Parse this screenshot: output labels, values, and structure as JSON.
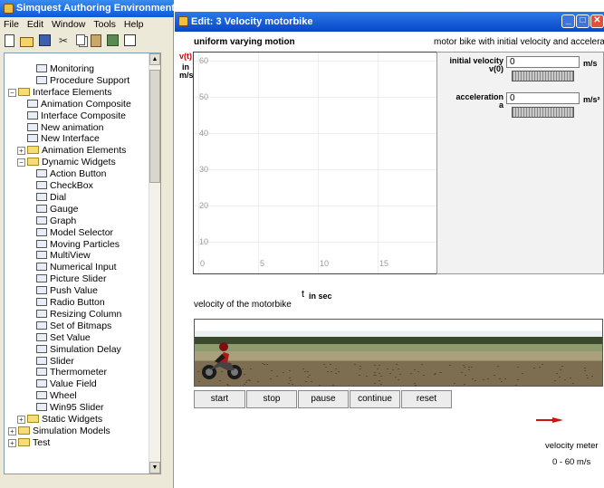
{
  "left_window": {
    "title": "Simquest Authoring Environment",
    "menu": [
      "File",
      "Edit",
      "Window",
      "Tools",
      "Help"
    ],
    "tree": [
      {
        "label": "Monitoring",
        "indent": 3,
        "type": "leaf"
      },
      {
        "label": "Procedure Support",
        "indent": 3,
        "type": "leaf"
      },
      {
        "label": "Interface Elements",
        "indent": 1,
        "type": "folder",
        "expander": "−"
      },
      {
        "label": "Animation Composite",
        "indent": 2,
        "type": "leaf"
      },
      {
        "label": "Interface Composite",
        "indent": 2,
        "type": "leaf"
      },
      {
        "label": "New animation",
        "indent": 2,
        "type": "leaf"
      },
      {
        "label": "New Interface",
        "indent": 2,
        "type": "leaf"
      },
      {
        "label": "Animation Elements",
        "indent": 2,
        "type": "folder",
        "expander": "+"
      },
      {
        "label": "Dynamic Widgets",
        "indent": 2,
        "type": "folder",
        "expander": "−"
      },
      {
        "label": "Action Button",
        "indent": 3,
        "type": "leaf"
      },
      {
        "label": "CheckBox",
        "indent": 3,
        "type": "leaf"
      },
      {
        "label": "Dial",
        "indent": 3,
        "type": "leaf"
      },
      {
        "label": "Gauge",
        "indent": 3,
        "type": "leaf"
      },
      {
        "label": "Graph",
        "indent": 3,
        "type": "leaf"
      },
      {
        "label": "Model Selector",
        "indent": 3,
        "type": "leaf"
      },
      {
        "label": "Moving Particles",
        "indent": 3,
        "type": "leaf"
      },
      {
        "label": "MultiView",
        "indent": 3,
        "type": "leaf"
      },
      {
        "label": "Numerical Input",
        "indent": 3,
        "type": "leaf"
      },
      {
        "label": "Picture Slider",
        "indent": 3,
        "type": "leaf"
      },
      {
        "label": "Push Value",
        "indent": 3,
        "type": "leaf"
      },
      {
        "label": "Radio Button",
        "indent": 3,
        "type": "leaf"
      },
      {
        "label": "Resizing Column",
        "indent": 3,
        "type": "leaf"
      },
      {
        "label": "Set of Bitmaps",
        "indent": 3,
        "type": "leaf"
      },
      {
        "label": "Set Value",
        "indent": 3,
        "type": "leaf"
      },
      {
        "label": "Simulation Delay",
        "indent": 3,
        "type": "leaf"
      },
      {
        "label": "Slider",
        "indent": 3,
        "type": "leaf"
      },
      {
        "label": "Thermometer",
        "indent": 3,
        "type": "leaf"
      },
      {
        "label": "Value Field",
        "indent": 3,
        "type": "leaf"
      },
      {
        "label": "Wheel",
        "indent": 3,
        "type": "leaf"
      },
      {
        "label": "Win95 Slider",
        "indent": 3,
        "type": "leaf"
      },
      {
        "label": "Static Widgets",
        "indent": 2,
        "type": "folder",
        "expander": "+"
      },
      {
        "label": "Simulation Models",
        "indent": 1,
        "type": "folder",
        "expander": "+"
      },
      {
        "label": "Test",
        "indent": 1,
        "type": "folder",
        "expander": "+"
      }
    ]
  },
  "right_window": {
    "title": "Edit: 3  Velocity motorbike",
    "graph_title": "uniform varying motion",
    "controls_title": "motor bike with initial velocity and acceleration",
    "graph": {
      "y_axis_label": "v(t)",
      "y_unit": "in\nm/s",
      "y_ticks": [
        "60",
        "50",
        "40",
        "30",
        "20",
        "10"
      ],
      "x_ticks": [
        "0",
        "5",
        "10",
        "15"
      ],
      "x_label_symbol": "t",
      "x_label_unit": "in sec"
    },
    "initial_velocity": {
      "label": "initial velocity\nv(0)",
      "value": "0",
      "unit": "m/s"
    },
    "acceleration": {
      "label": "acceleration\na",
      "value": "0",
      "unit": "m/s²"
    },
    "animation_title": "velocity of the motorbike",
    "buttons": [
      "start",
      "stop",
      "pause",
      "continue",
      "reset"
    ],
    "meter": {
      "name": "velocity meter",
      "range": "0 - 60 m/s"
    }
  }
}
